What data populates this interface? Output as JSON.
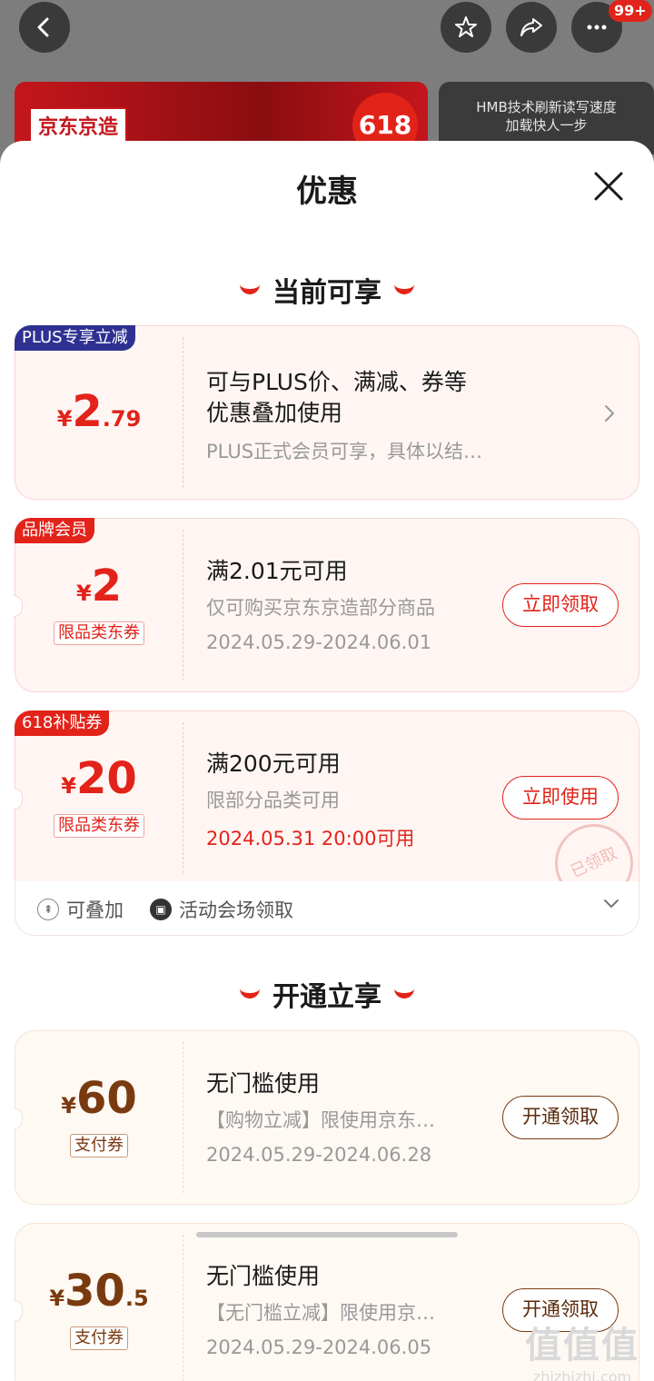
{
  "background": {
    "badge": "99+",
    "banner_left_logo": "京东京造",
    "banner_left_badge": "618",
    "banner_right_text_1": "HMB技术刷新读写速度",
    "banner_right_text_2": "加载快人一步"
  },
  "sheet": {
    "title": "优惠",
    "section_current": "当前可享",
    "section_open": "开通立享"
  },
  "cards": [
    {
      "tag": "PLUS专享立减",
      "currency": "¥",
      "amount_int": "2",
      "amount_dec": ".79",
      "line1": "可与PLUS价、满减、券等",
      "line1b": "优惠叠加使用",
      "line2": "PLUS正式会员可享，具体以结…"
    },
    {
      "tag": "品牌会员",
      "currency": "¥",
      "amount_int": "2",
      "sub_tag": "限品类东券",
      "line1": "满2.01元可用",
      "line2": "仅可购买京东京造部分商品",
      "line3": "2024.05.29-2024.06.01",
      "button": "立即领取"
    },
    {
      "tag": "618补贴券",
      "currency": "¥",
      "amount_int": "20",
      "sub_tag": "限品类东券",
      "line1": "满200元可用",
      "line2": "限部分品类可用",
      "line3": "2024.05.31 20:00可用",
      "button": "立即使用",
      "stamp": "已领取"
    },
    {
      "currency": "¥",
      "amount_int": "60",
      "sub_tag": "支付券",
      "line1": "无门槛使用",
      "line2": "【购物立减】限使用京东…",
      "line3": "2024.05.29-2024.06.28",
      "button": "开通领取"
    },
    {
      "currency": "¥",
      "amount_int": "30",
      "amount_dec": ".5",
      "sub_tag": "支付券",
      "line1": "无门槛使用",
      "line2": "【无门槛立减】限使用京…",
      "line3": "2024.05.29-2024.06.05",
      "button": "开通领取"
    }
  ],
  "footer": {
    "stackable": "可叠加",
    "venue": "活动会场领取"
  },
  "watermark": {
    "main": "值值值",
    "sub": "zhizhizhi.com"
  },
  "colors": {
    "accent_red": "#e2231a",
    "plus_blue": "#2e3192",
    "gold_brown": "#7a3a10"
  }
}
